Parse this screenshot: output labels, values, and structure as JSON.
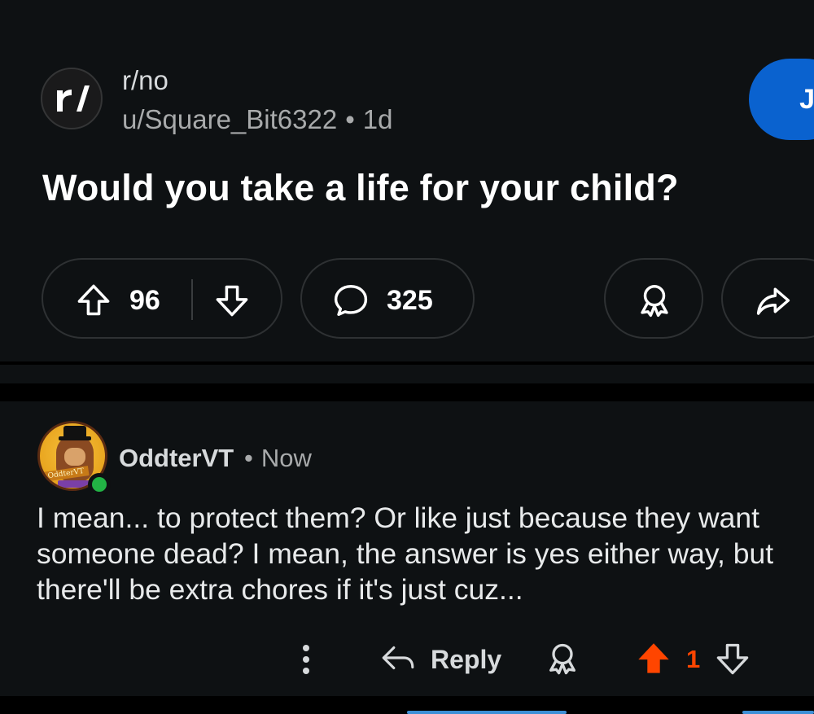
{
  "post": {
    "subreddit": "r/no",
    "author": "u/Square_Bit6322",
    "separator": "•",
    "age": "1d",
    "join_label": "Jo",
    "title": "Would you take a life for your child?",
    "upvotes": "96",
    "comments": "325"
  },
  "comment": {
    "author": "OddterVT",
    "separator": "•",
    "age": "Now",
    "body": "I mean... to protect them? Or like just because they want someone dead? I mean, the answer is yes either way, but there'll be extra chores if it's just cuz...",
    "avatar_banner_text": "OddterVT",
    "reply_label": "Reply",
    "score": "1",
    "upvoted": true
  },
  "colors": {
    "background": "#0e1113",
    "join_button": "#0a62cf",
    "upvote_active": "#ff4500",
    "online": "#22b345"
  },
  "icons": {
    "subreddit": "reddit-r-slash-icon",
    "upvote": "arrow-up-icon",
    "downvote": "arrow-down-icon",
    "comment": "speech-bubble-icon",
    "award": "award-ribbon-icon",
    "share": "share-arrow-icon",
    "more": "vertical-ellipsis-icon",
    "reply": "reply-arrow-icon"
  }
}
